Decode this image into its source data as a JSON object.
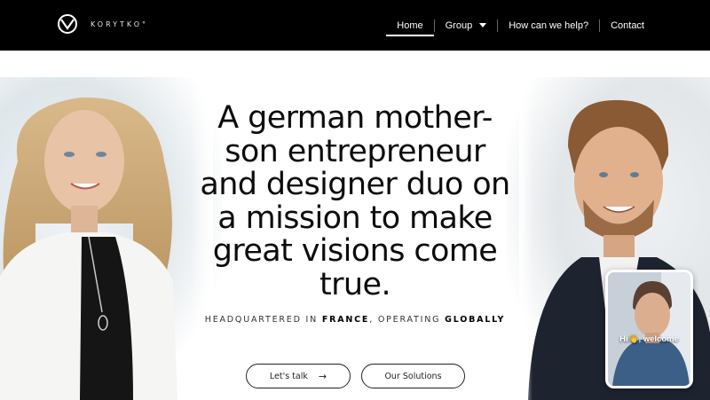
{
  "brand": {
    "name": "KORYTKO°",
    "logo_icon": "korytko-logo-icon"
  },
  "nav": {
    "items": [
      {
        "label": "Home",
        "active": true
      },
      {
        "label": "Group",
        "has_dropdown": true
      },
      {
        "label": "How can we help?"
      },
      {
        "label": "Contact"
      }
    ]
  },
  "hero": {
    "headline": "A german mother-son entrepreneur and designer duo on a mission to make great visions come true.",
    "tagline_prefix": "HEADQUARTERED IN ",
    "tagline_country": "FRANCE",
    "tagline_middle": ", OPERATING ",
    "tagline_scope": "GLOBALLY",
    "cta_primary": "Let's talk",
    "cta_primary_icon": "arrow-right-icon",
    "cta_secondary": "Our Solutions"
  },
  "video_widget": {
    "greeting": "Hi👋, welcome"
  },
  "colors": {
    "nav_bg": "#000000",
    "nav_text": "#ffffff",
    "page_bg": "#ffffff",
    "text": "#0c0c0c"
  }
}
